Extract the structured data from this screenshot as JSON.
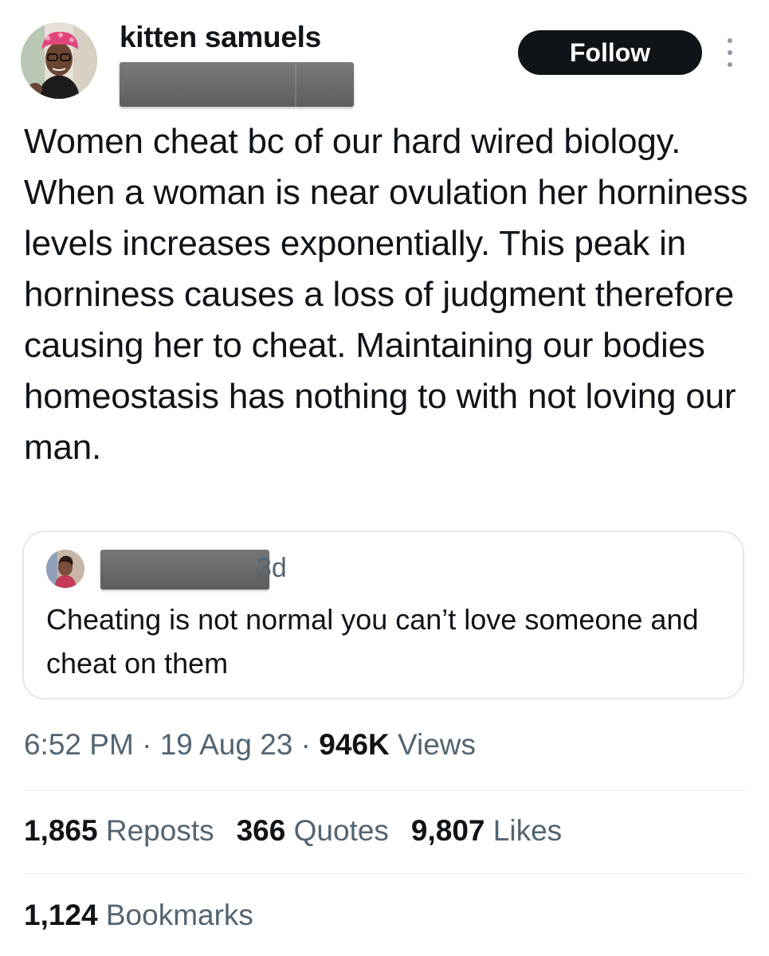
{
  "author": {
    "name": "kitten samuels",
    "avatar_icon": "profile-photo"
  },
  "follow_button": {
    "label": "Follow"
  },
  "more_icon": "vertical-ellipsis-icon",
  "tweet": {
    "text": "Women cheat bc of our hard wired biology. When a woman is near ovulation her horniness levels increases exponentially. This peak in horniness causes a loss of judgment therefore causing her to cheat. Maintaining our bodies homeostasis has nothing to with not loving our man."
  },
  "quoted_tweet": {
    "time": "3d",
    "text": "Cheating is not normal you can’t love someone and cheat on them"
  },
  "meta": {
    "time": "6:52 PM",
    "separator": " · ",
    "date": "19 Aug 23",
    "views_count": "946K",
    "views_label": "Views"
  },
  "stats": {
    "reposts_count": "1,865",
    "reposts_label": "Reposts",
    "quotes_count": "366",
    "quotes_label": "Quotes",
    "likes_count": "9,807",
    "likes_label": "Likes",
    "bookmarks_count": "1,124",
    "bookmarks_label": "Bookmarks"
  },
  "colors": {
    "text_primary": "#0f1419",
    "text_secondary": "#536471",
    "button_bg": "#0f1419",
    "border": "#e3e7ea"
  }
}
